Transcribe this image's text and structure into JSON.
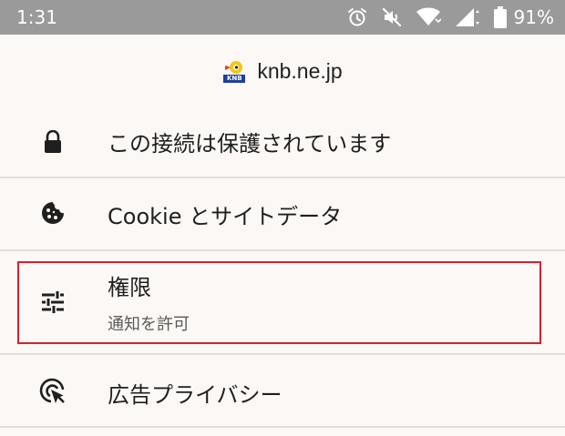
{
  "status_bar": {
    "time": "1:31",
    "battery_percent": "91%",
    "icons": [
      "alarm-icon",
      "mute-icon",
      "wifi-icon",
      "signal-icon",
      "battery-icon"
    ]
  },
  "site": {
    "domain": "knb.ne.jp",
    "logo_text": "KNB"
  },
  "menu": {
    "connection": {
      "label": "この接続は保護されています",
      "icon": "lock-icon"
    },
    "cookies": {
      "label": "Cookie とサイトデータ",
      "icon": "cookie-icon"
    },
    "permissions": {
      "label": "権限",
      "sublabel": "通知を許可",
      "icon": "sliders-icon"
    },
    "ad_privacy": {
      "label": "広告プライバシー",
      "icon": "ad-privacy-icon"
    }
  },
  "colors": {
    "highlight": "#d8202a",
    "status_bar": "#9a9a9a",
    "background": "#fcf8f5"
  }
}
